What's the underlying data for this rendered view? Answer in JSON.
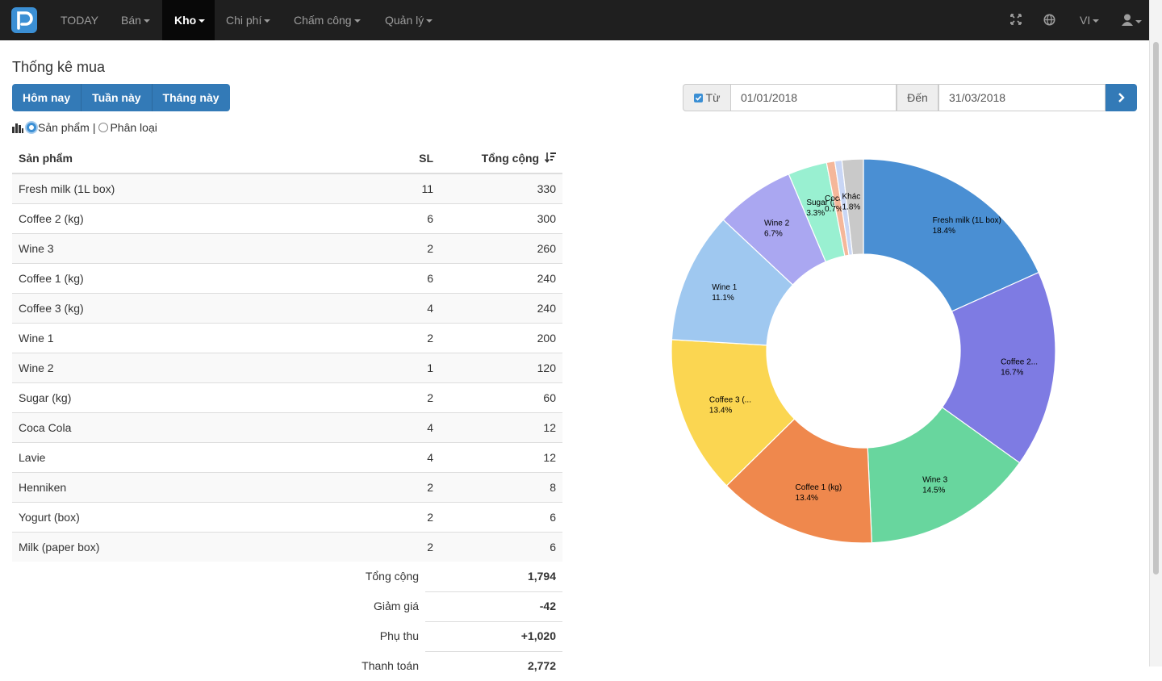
{
  "nav": {
    "items": [
      {
        "label": "TODAY",
        "caret": false,
        "active": false
      },
      {
        "label": "Bán",
        "caret": true,
        "active": false
      },
      {
        "label": "Kho",
        "caret": true,
        "active": true
      },
      {
        "label": "Chi phí",
        "caret": true,
        "active": false
      },
      {
        "label": "Chấm công",
        "caret": true,
        "active": false
      },
      {
        "label": "Quản lý",
        "caret": true,
        "active": false
      }
    ],
    "language": "VI",
    "icons": [
      "fullscreen-icon",
      "globe-icon",
      "user-icon"
    ]
  },
  "page": {
    "title": "Thống kê mua",
    "ranges": [
      "Hôm nay",
      "Tuần này",
      "Tháng này"
    ],
    "mode_options": [
      "Sản phẩm",
      "Phân loại"
    ],
    "mode_separator": "|",
    "selected_mode": "Sản phẩm"
  },
  "date_filter": {
    "from_label": "Từ",
    "from_checked": true,
    "from_value": "01/01/2018",
    "to_label": "Đến",
    "to_value": "31/03/2018"
  },
  "table": {
    "headers": {
      "product": "Sản phẩm",
      "qty": "SL",
      "total": "Tổng cộng"
    },
    "rows": [
      {
        "product": "Fresh milk (1L box)",
        "qty": "11",
        "total": "330"
      },
      {
        "product": "Coffee 2 (kg)",
        "qty": "6",
        "total": "300"
      },
      {
        "product": "Wine 3",
        "qty": "2",
        "total": "260"
      },
      {
        "product": "Coffee 1 (kg)",
        "qty": "6",
        "total": "240"
      },
      {
        "product": "Coffee 3 (kg)",
        "qty": "4",
        "total": "240"
      },
      {
        "product": "Wine 1",
        "qty": "2",
        "total": "200"
      },
      {
        "product": "Wine 2",
        "qty": "1",
        "total": "120"
      },
      {
        "product": "Sugar (kg)",
        "qty": "2",
        "total": "60"
      },
      {
        "product": "Coca Cola",
        "qty": "4",
        "total": "12"
      },
      {
        "product": "Lavie",
        "qty": "4",
        "total": "12"
      },
      {
        "product": "Henniken",
        "qty": "2",
        "total": "8"
      },
      {
        "product": "Yogurt (box)",
        "qty": "2",
        "total": "6"
      },
      {
        "product": "Milk (paper box)",
        "qty": "2",
        "total": "6"
      }
    ],
    "summary": [
      {
        "label": "Tổng cộng",
        "value": "1,794"
      },
      {
        "label": "Giảm giá",
        "value": "-42"
      },
      {
        "label": "Phụ thu",
        "value": "+1,020"
      },
      {
        "label": "Thanh toán",
        "value": "2,772"
      }
    ]
  },
  "chart_data": {
    "type": "pie",
    "donut": true,
    "series": [
      {
        "label": "Fresh milk (1L box)",
        "percent": 18.4,
        "pct_text": "18.4%",
        "color": "#4a8fd3"
      },
      {
        "label": "Coffee 2...",
        "percent": 16.7,
        "pct_text": "16.7%",
        "color": "#7e7be3"
      },
      {
        "label": "Wine 3",
        "percent": 14.5,
        "pct_text": "14.5%",
        "color": "#68d69e"
      },
      {
        "label": "Coffee 1 (kg)",
        "percent": 13.4,
        "pct_text": "13.4%",
        "color": "#ef884d"
      },
      {
        "label": "Coffee 3 (...",
        "percent": 13.4,
        "pct_text": "13.4%",
        "color": "#fbd651"
      },
      {
        "label": "Wine 1",
        "percent": 11.1,
        "pct_text": "11.1%",
        "color": "#9fc8f0"
      },
      {
        "label": "Wine 2",
        "percent": 6.7,
        "pct_text": "6.7%",
        "color": "#aaa7f1"
      },
      {
        "label": "Sugar (kg)",
        "percent": 3.3,
        "pct_text": "3.3%",
        "color": "#99f0d1"
      },
      {
        "label": "Coca...",
        "percent": 0.7,
        "pct_text": "0.7%",
        "color": "#f5b79a"
      },
      {
        "label": "",
        "percent": 0.6,
        "pct_text": "",
        "color": "#c9d6f5"
      },
      {
        "label": "Khác",
        "percent": 1.8,
        "pct_text": "1.8%",
        "color": "#c9c9c9"
      }
    ]
  }
}
